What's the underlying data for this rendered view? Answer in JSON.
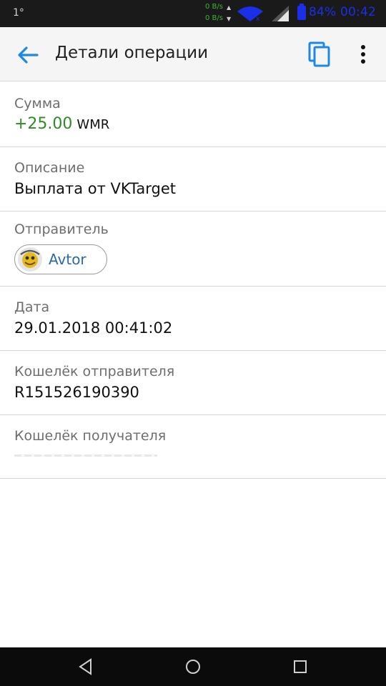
{
  "status_bar": {
    "left_indicator": "1°",
    "speed_up": "0 B/s",
    "speed_down": "0 B/s",
    "battery_time": "84% 00:42",
    "colors": {
      "speed": "#3db534",
      "battery_text": "#1b2fe8"
    }
  },
  "app_bar": {
    "title": "Детали операции",
    "icons": {
      "back": "arrow-left",
      "copy": "copy",
      "more": "more-vertical"
    },
    "accent": "#1e88e5"
  },
  "details": {
    "amount": {
      "label": "Сумма",
      "value": "+25.00",
      "currency": "WMR",
      "color": "#2e8b25"
    },
    "description": {
      "label": "Описание",
      "value": "Выплата от VKTarget"
    },
    "sender": {
      "label": "Отправитель",
      "name": "Avtor"
    },
    "date": {
      "label": "Дата",
      "value": "29.01.2018 00:41:02"
    },
    "sender_wallet": {
      "label": "Кошелёк отправителя",
      "value": "R151526190390"
    },
    "receiver_wallet": {
      "label": "Кошелёк получателя"
    }
  },
  "nav_bar": {
    "icons": [
      "back-triangle",
      "home-circle",
      "recents-square"
    ]
  }
}
